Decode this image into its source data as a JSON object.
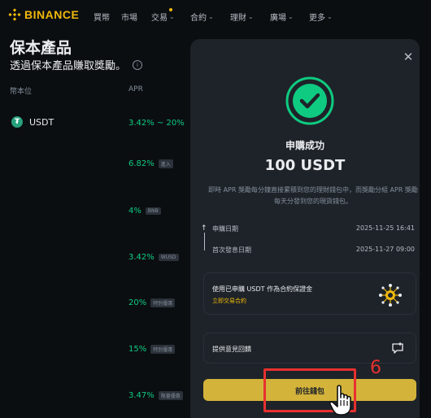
{
  "nav": {
    "logo_text": "BINANCE",
    "items": [
      {
        "label": "買幣",
        "chevron": false
      },
      {
        "label": "市場",
        "chevron": false
      },
      {
        "label": "交易",
        "chevron": true
      },
      {
        "label": "合約",
        "chevron": true
      },
      {
        "label": "理財",
        "chevron": true
      },
      {
        "label": "廣場",
        "chevron": true
      },
      {
        "label": "更多",
        "chevron": true
      }
    ]
  },
  "page": {
    "title": "保本產品",
    "subtitle": "透過保本產品賺取獎勵。",
    "col_currency": "幣本位",
    "col_apr": "APR",
    "coin_name": "USDT",
    "apr_rows": [
      {
        "value": "3.42% ~ 20%",
        "tag": ""
      },
      {
        "value": "6.82%",
        "tag": "進入"
      },
      {
        "value": "4%",
        "tag": "BNB"
      },
      {
        "value": "3.42%",
        "tag": "WUSD"
      },
      {
        "value": "20%",
        "tag": "特別優惠"
      },
      {
        "value": "15%",
        "tag": "特別優惠"
      },
      {
        "value": "3.47%",
        "tag": "限量優惠"
      }
    ]
  },
  "modal": {
    "close_icon": "close-icon",
    "success_title": "申購成功",
    "amount": "100 USDT",
    "description": "即時 APR 獎勵每分鐘直接累積到您的理財錢包中，而獎勵分組 APR 獎勵每天分發到您的現貨錢包。",
    "timeline": [
      {
        "label": "申購日期",
        "value": "2025-11-25 16:41"
      },
      {
        "label": "首次發息日期",
        "value": "2025-11-27 09:00"
      }
    ],
    "collateral_card": {
      "text": "使用已申購 USDT 作為合約保證金",
      "link": "立即交易合約"
    },
    "feedback_card": {
      "text": "提供意見回饋"
    },
    "wallet_button": "前往錢包"
  },
  "annotation": {
    "step_number": "6"
  },
  "colors": {
    "brand": "#f0b90b",
    "success": "#0ecb81",
    "highlight": "#e8302f"
  }
}
